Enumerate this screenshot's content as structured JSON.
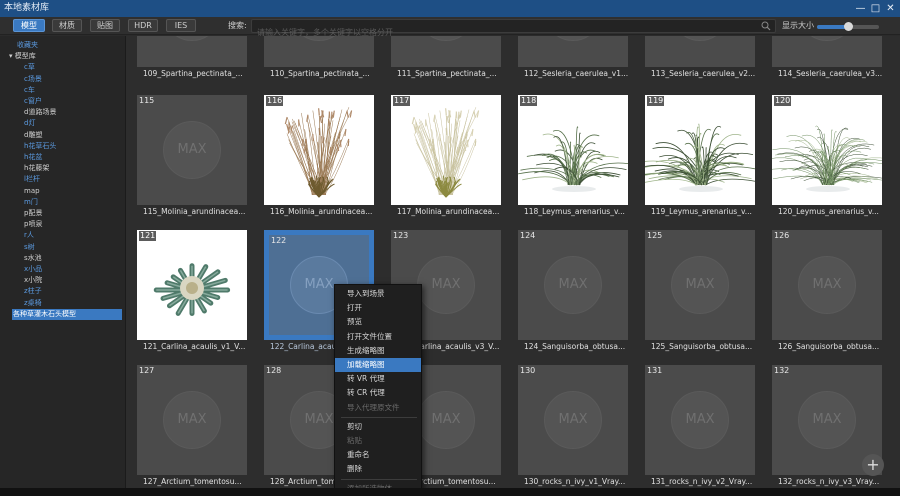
{
  "window": {
    "title": "本地素材库",
    "controls": [
      "—",
      "□",
      "✕"
    ]
  },
  "toolbar": {
    "tabs": [
      {
        "label": "模型",
        "active": true
      },
      {
        "label": "材质",
        "active": false
      },
      {
        "label": "贴图",
        "active": false
      },
      {
        "label": "HDR",
        "active": false
      },
      {
        "label": "IES",
        "active": false
      }
    ],
    "search_label": "搜索:",
    "search_placeholder": "请输入关键字，多个关键字以空格分开",
    "size_label": "显示大小",
    "size_value": 0.5
  },
  "sidebar": {
    "items": [
      {
        "label": "收藏夹",
        "style": "blue",
        "indent": 0
      },
      {
        "label": "▾ 模型库",
        "style": "normal",
        "indent": 0
      },
      {
        "label": "c草",
        "style": "blue",
        "indent": 1
      },
      {
        "label": "c场景",
        "style": "blue",
        "indent": 1
      },
      {
        "label": "c车",
        "style": "blue",
        "indent": 1
      },
      {
        "label": "c窗户",
        "style": "blue",
        "indent": 1
      },
      {
        "label": "d道路场景",
        "style": "normal",
        "indent": 1
      },
      {
        "label": "d灯",
        "style": "blue",
        "indent": 1
      },
      {
        "label": "d雕塑",
        "style": "normal",
        "indent": 1
      },
      {
        "label": "h花草石头",
        "style": "blue",
        "indent": 1
      },
      {
        "label": "h花盆",
        "style": "blue",
        "indent": 1
      },
      {
        "label": "h花藤架",
        "style": "normal",
        "indent": 1
      },
      {
        "label": "l栏杆",
        "style": "blue",
        "indent": 1
      },
      {
        "label": "map",
        "style": "normal",
        "indent": 1
      },
      {
        "label": "m门",
        "style": "blue",
        "indent": 1
      },
      {
        "label": "p配景",
        "style": "normal",
        "indent": 1
      },
      {
        "label": "p喷泉",
        "style": "normal",
        "indent": 1
      },
      {
        "label": "r人",
        "style": "blue",
        "indent": 1
      },
      {
        "label": "s树",
        "style": "blue",
        "indent": 1
      },
      {
        "label": "s水池",
        "style": "normal",
        "indent": 1
      },
      {
        "label": "x小品",
        "style": "blue",
        "indent": 1
      },
      {
        "label": "x小院",
        "style": "normal",
        "indent": 1
      },
      {
        "label": "z柱子",
        "style": "blue",
        "indent": 1
      },
      {
        "label": "z桌椅",
        "style": "blue",
        "indent": 1
      },
      {
        "label": "各种草灌木石头模型",
        "style": "selected",
        "indent": 1
      }
    ]
  },
  "grid": {
    "top_row_labels": [
      "109_Spartina_pectinata_...",
      "110_Spartina_pectinata_...",
      "111_Spartina_pectinata_...",
      "112_Sesleria_caerulea_v1...",
      "113_Sesleria_caerulea_v2...",
      "114_Sesleria_caerulea_v3..."
    ],
    "rows": [
      [
        {
          "num": "115",
          "label": "115_Molinia_arundinacea...",
          "type": "max"
        },
        {
          "num": "116",
          "label": "116_Molinia_arundinacea...",
          "type": "plant",
          "plant": "tall-grass-brown"
        },
        {
          "num": "117",
          "label": "117_Molinia_arundinacea...",
          "type": "plant",
          "plant": "tall-grass-light"
        },
        {
          "num": "118",
          "label": "118_Leymus_arenarius_v...",
          "type": "plant",
          "plant": "leymus"
        },
        {
          "num": "119",
          "label": "119_Leymus_arenarius_v...",
          "type": "plant",
          "plant": "leymus-dense"
        },
        {
          "num": "120",
          "label": "120_Leymus_arenarius_v...",
          "type": "plant",
          "plant": "leymus-fine"
        }
      ],
      [
        {
          "num": "121",
          "label": "121_Carlina_acaulis_v1_V...",
          "type": "plant",
          "plant": "carlina"
        },
        {
          "num": "122",
          "label": "122_Carlina_acaulis_v2_V...",
          "type": "max",
          "selected": true
        },
        {
          "num": "123",
          "label": "123_Carlina_acaulis_v3_V...",
          "type": "max"
        },
        {
          "num": "124",
          "label": "124_Sanguisorba_obtusa...",
          "type": "max"
        },
        {
          "num": "125",
          "label": "125_Sanguisorba_obtusa...",
          "type": "max"
        },
        {
          "num": "126",
          "label": "126_Sanguisorba_obtusa...",
          "type": "max"
        }
      ],
      [
        {
          "num": "127",
          "label": "127_Arctium_tomentosu...",
          "type": "max"
        },
        {
          "num": "128",
          "label": "128_Arctium_tomentosu...",
          "type": "max"
        },
        {
          "num": "129",
          "label": "129_Arctium_tomentosu...",
          "type": "max"
        },
        {
          "num": "130",
          "label": "130_rocks_n_ivy_v1_Vray...",
          "type": "max"
        },
        {
          "num": "131",
          "label": "131_rocks_n_ivy_v2_Vray...",
          "type": "max"
        },
        {
          "num": "132",
          "label": "132_rocks_n_ivy_v3_Vray...",
          "type": "max"
        }
      ]
    ],
    "max_text": "MAX"
  },
  "context_menu": {
    "items": [
      {
        "label": "导入到场景",
        "state": "normal"
      },
      {
        "label": "打开",
        "state": "normal"
      },
      {
        "label": "预览",
        "state": "normal"
      },
      {
        "label": "打开文件位置",
        "state": "normal"
      },
      {
        "label": "生成缩略图",
        "state": "normal"
      },
      {
        "label": "加载缩略图",
        "state": "highlight"
      },
      {
        "label": "转 VR 代理",
        "state": "normal"
      },
      {
        "label": "转 CR 代理",
        "state": "normal"
      },
      {
        "label": "导入代理原文件",
        "state": "disabled"
      },
      {
        "label": "---",
        "state": "separator"
      },
      {
        "label": "剪切",
        "state": "normal"
      },
      {
        "label": "粘贴",
        "state": "disabled"
      },
      {
        "label": "重命名",
        "state": "normal"
      },
      {
        "label": "删除",
        "state": "normal"
      },
      {
        "label": "---",
        "state": "separator"
      },
      {
        "label": "添加所选物体",
        "state": "disabled"
      }
    ]
  },
  "fab_label": "+"
}
